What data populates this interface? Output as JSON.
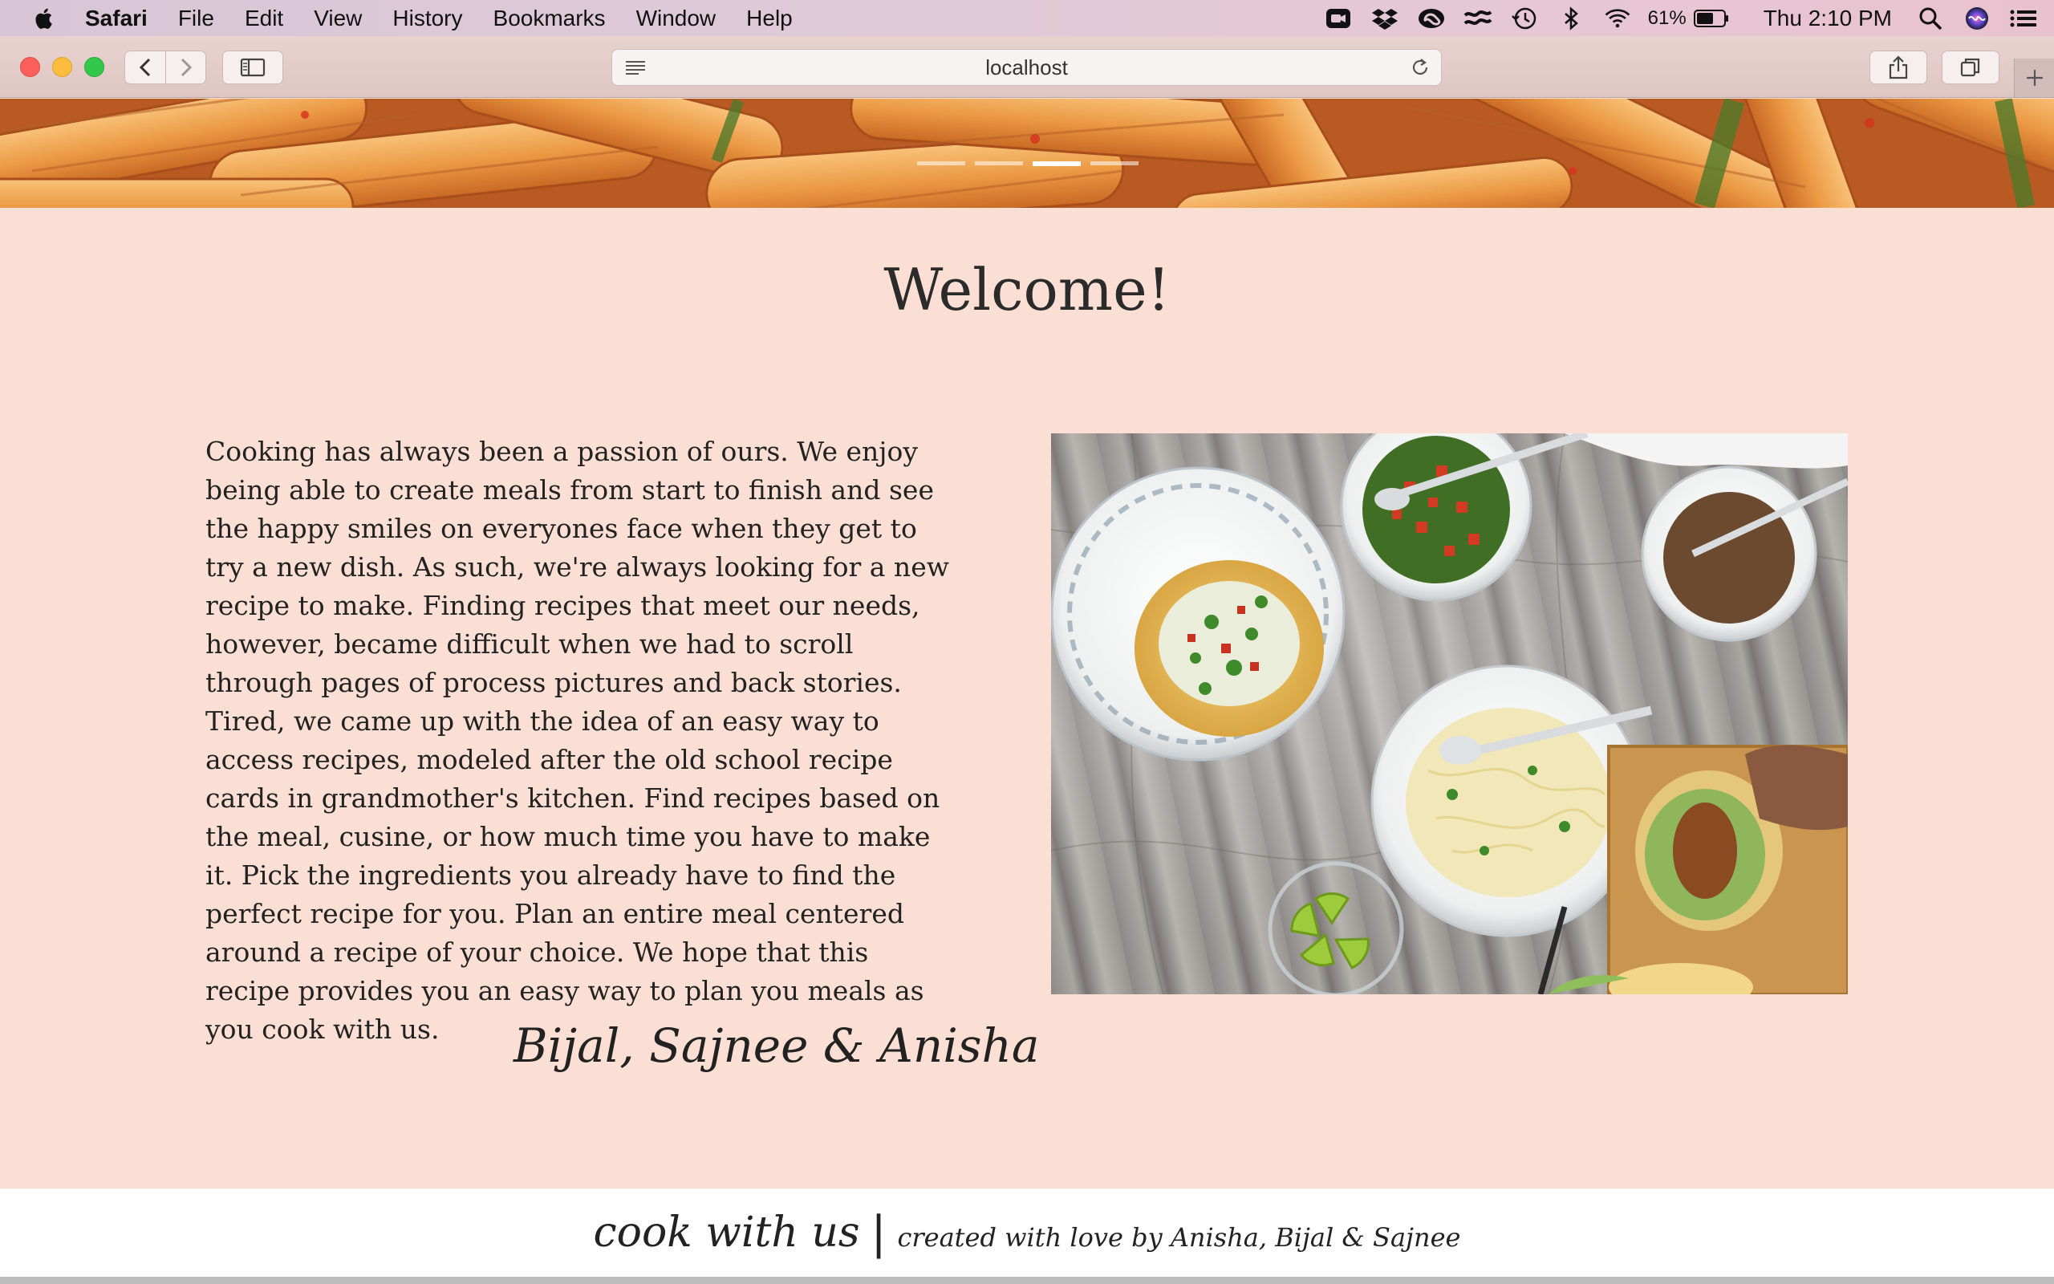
{
  "menubar": {
    "app_name": "Safari",
    "menus": [
      "File",
      "Edit",
      "View",
      "History",
      "Bookmarks",
      "Window",
      "Help"
    ],
    "battery_percent": "61%",
    "clock": "Thu 2:10 PM"
  },
  "browser": {
    "address": "localhost"
  },
  "hero": {
    "slide_count": 4,
    "active_slide": 3
  },
  "content": {
    "heading": "Welcome!",
    "paragraph": "Cooking has always been a passion of ours. We enjoy being able to create meals from start to finish and see the happy smiles on everyones face when they get to try a new dish. As such, we're always looking for a new recipe to make. Finding recipes that meet our needs, however, became difficult when we had to scroll through pages of process pictures and back stories. Tired, we came up with the idea of an easy way to access recipes, modeled after the old school recipe cards in grandmother's kitchen. Find recipes based on the meal, cusine, or how much time you have to make it. Pick the ingredients you already have to find the perfect recipe for you. Plan an entire meal centered around a recipe of your choice. We hope that this recipe provides you an easy way to plan you meals as you cook with us.",
    "signature": "Bijal, Sajnee & Anisha"
  },
  "footer": {
    "brand": "cook with us",
    "separator": "|",
    "credit": "created with love by Anisha, Bijal & Sajnee"
  }
}
